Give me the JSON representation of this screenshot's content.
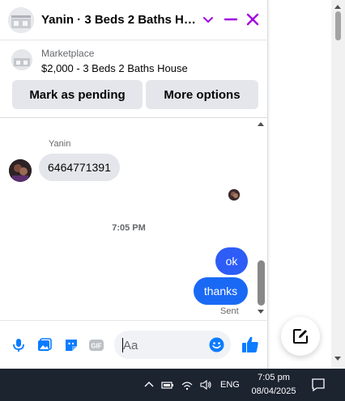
{
  "header": {
    "title": "Yanin · 3 Beds 2 Baths House",
    "accent": "#a100e0"
  },
  "listing": {
    "kind": "Marketplace",
    "price_title": "$2,000 - 3 Beds 2 Baths House",
    "pending_label": "Mark as pending",
    "more_label": "More options"
  },
  "messages": {
    "sender_name": "Yanin",
    "incoming": "6464771391",
    "time_divider": "7:05 PM",
    "outgoing": [
      "ok",
      "thanks"
    ],
    "status": "Sent"
  },
  "composer": {
    "placeholder": "Aa",
    "icons": [
      "microphone-icon",
      "photo-icon",
      "sticker-icon",
      "gif-icon",
      "emoji-icon",
      "thumbs-up-icon"
    ],
    "accent": "#0a7cff"
  },
  "taskbar": {
    "language": "ENG",
    "time": "7:05 pm",
    "date": "08/04/2025"
  }
}
